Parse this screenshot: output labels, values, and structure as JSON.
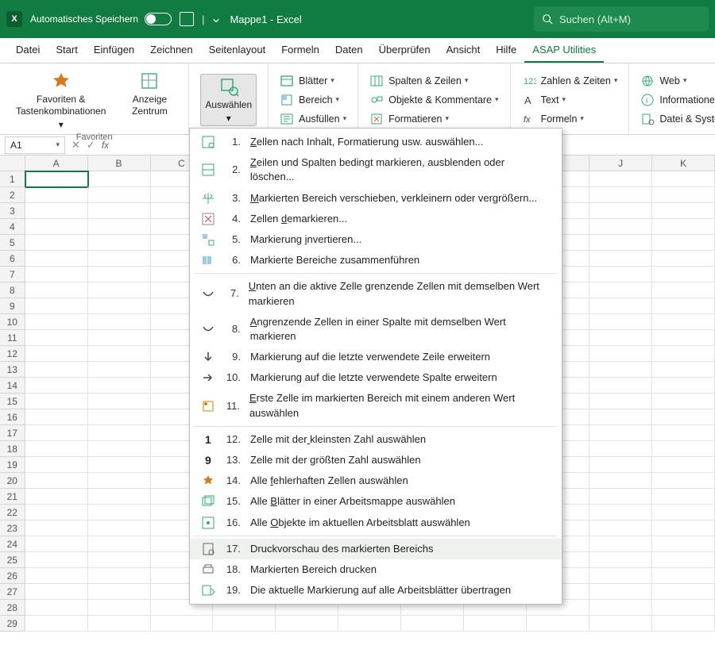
{
  "titlebar": {
    "autosave_label": "Automatisches Speichern",
    "doc_title": "Mappe1  -  Excel",
    "search_placeholder": "Suchen (Alt+M)"
  },
  "tabs": [
    "Datei",
    "Start",
    "Einfügen",
    "Zeichnen",
    "Seitenlayout",
    "Formeln",
    "Daten",
    "Überprüfen",
    "Ansicht",
    "Hilfe",
    "ASAP Utilities"
  ],
  "active_tab": "ASAP Utilities",
  "ribbon": {
    "group_favorites_label": "Favoriten",
    "favorites_btn": "Favoriten &\nTastenkombinationen",
    "anzeige_btn": "Anzeige\nZentrum",
    "auswahl_btn": "Auswählen",
    "col1": [
      "Blätter",
      "Bereich",
      "Ausfüllen"
    ],
    "col2": [
      "Spalten & Zeilen",
      "Objekte & Kommentare",
      "Formatieren"
    ],
    "col3": [
      "Zahlen & Zeiten",
      "Text",
      "Formeln"
    ],
    "col4": [
      "Web",
      "Informationen",
      "Datei & System"
    ]
  },
  "namebox": "A1",
  "columns": [
    "A",
    "B",
    "C",
    "D",
    "E",
    "F",
    "G",
    "H",
    "I",
    "J",
    "K"
  ],
  "row_count": 29,
  "dropdown": [
    {
      "n": 1,
      "t": "Zellen nach Inhalt, Formatierung usw. auswählen...",
      "u": 0
    },
    {
      "n": 2,
      "t": "Zeilen und Spalten bedingt markieren, ausblenden oder löschen...",
      "u": 0
    },
    {
      "n": 3,
      "t": "Markierten Bereich verschieben, verkleinern oder vergrößern...",
      "u": 0
    },
    {
      "n": 4,
      "t": "Zellen demarkieren...",
      "u": 7
    },
    {
      "n": 5,
      "t": "Markierung invertieren...",
      "u": 11
    },
    {
      "n": 6,
      "t": "Markierte Bereiche zusammenführen",
      "u": -1
    },
    {
      "n": 7,
      "t": "Unten an die aktive Zelle grenzende Zellen mit demselben Wert markieren",
      "u": 0
    },
    {
      "n": 8,
      "t": "Angrenzende Zellen in einer Spalte mit demselben Wert markieren",
      "u": 0
    },
    {
      "n": 9,
      "t": "Markierung auf die letzte verwendete Zeile erweitern",
      "u": -1
    },
    {
      "n": 10,
      "t": "Markierung auf die letzte verwendete Spalte erweitern",
      "u": -1
    },
    {
      "n": 11,
      "t": "Erste Zelle im markierten Bereich mit einem anderen Wert auswählen",
      "u": 0
    },
    {
      "n": 12,
      "t": "Zelle mit der kleinsten Zahl auswählen",
      "u": 13
    },
    {
      "n": 13,
      "t": "Zelle mit der größten Zahl auswählen",
      "u": 14
    },
    {
      "n": 14,
      "t": "Alle fehlerhaften Zellen auswählen",
      "u": 5
    },
    {
      "n": 15,
      "t": "Alle Blätter in einer Arbeitsmappe auswählen",
      "u": 5
    },
    {
      "n": 16,
      "t": "Alle Objekte im aktuellen Arbeitsblatt auswählen",
      "u": 5
    },
    {
      "n": 17,
      "t": "Druckvorschau des markierten Bereichs",
      "u": -1,
      "hover": true
    },
    {
      "n": 18,
      "t": "Markierten Bereich drucken",
      "u": -1
    },
    {
      "n": 19,
      "t": "Die aktuelle Markierung auf alle Arbeitsblätter übertragen",
      "u": -1
    }
  ],
  "dd_separators_after": [
    6,
    11,
    16
  ]
}
